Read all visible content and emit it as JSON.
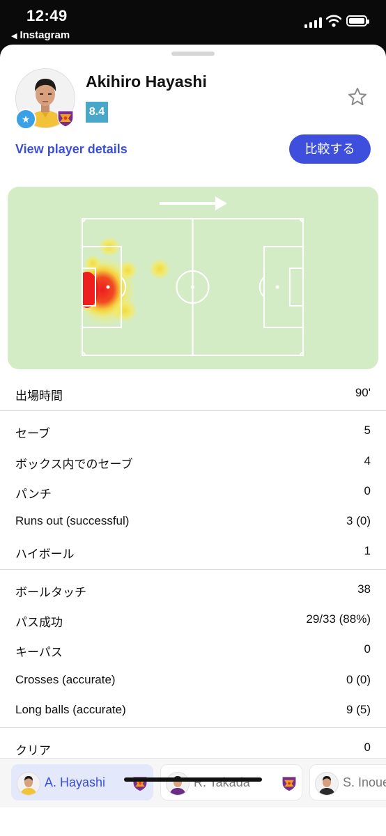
{
  "status_bar": {
    "time": "12:49",
    "back_app": "Instagram"
  },
  "player": {
    "name": "Akihiro Hayashi",
    "rating": "8.4"
  },
  "actions": {
    "details_link": "View player details",
    "compare_button": "比較する"
  },
  "colors": {
    "accent": "#3e4fdd",
    "rating_bg": "#49a8c9",
    "pitch": "#d4ecc6",
    "heat_hot": "#ef2a24",
    "heat_warm": "#f7ea5a"
  },
  "heatmap": {
    "attack_direction": "right"
  },
  "stats": {
    "group1": [
      {
        "label": "出場時間",
        "value": "90'"
      }
    ],
    "group2": [
      {
        "label": "セーブ",
        "value": "5"
      },
      {
        "label": "ボックス内でのセーブ",
        "value": "4"
      },
      {
        "label": "パンチ",
        "value": "0"
      },
      {
        "label": "Runs out (successful)",
        "value": "3 (0)"
      },
      {
        "label": "ハイボール",
        "value": "1"
      }
    ],
    "group3": [
      {
        "label": "ボールタッチ",
        "value": "38"
      },
      {
        "label": "パス成功",
        "value": "29/33 (88%)"
      },
      {
        "label": "キーパス",
        "value": "0"
      },
      {
        "label": "Crosses (accurate)",
        "value": "0 (0)"
      },
      {
        "label": "Long balls (accurate)",
        "value": "9 (5)"
      }
    ],
    "group4": [
      {
        "label": "クリア",
        "value": "0"
      }
    ]
  },
  "player_tabs": [
    {
      "name": "A. Hayashi",
      "active": true
    },
    {
      "name": "R. Takada",
      "active": false
    },
    {
      "name": "S. Inoue",
      "active": false
    }
  ]
}
